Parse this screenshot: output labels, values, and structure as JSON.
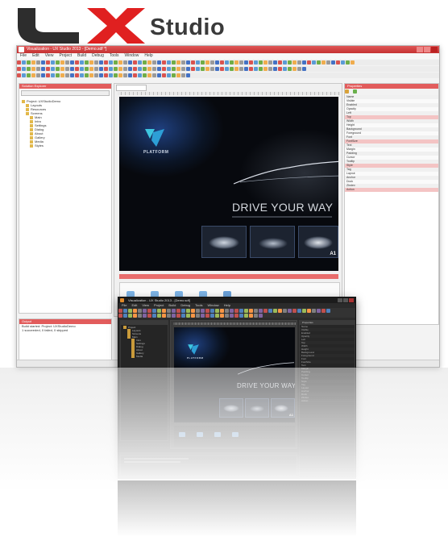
{
  "logo": {
    "brand_letters": "UX",
    "product": "Studio"
  },
  "light_window": {
    "title": "Visualization - UX Studio 2013 - [Demo.sdf *]",
    "menu": [
      "File",
      "Edit",
      "View",
      "Project",
      "Build",
      "Debug",
      "Tools",
      "Window",
      "Help"
    ],
    "left_panel_title": "Solution Explorer",
    "tree": [
      "Project: UXStudioDemo",
      "Layouts",
      "Resources",
      "Screens",
      "Main",
      "Intro",
      "Settings",
      "Dialog",
      "About",
      "Gallery",
      "Media",
      "Styles"
    ],
    "properties_title": "Properties",
    "properties": [
      "Name",
      "Visible",
      "Enabled",
      "Opacity",
      "Left",
      "Top",
      "Width",
      "Height",
      "Background",
      "Foreground",
      "Font",
      "FontSize",
      "Text",
      "Margin",
      "Padding",
      "Cursor",
      "Tooltip",
      "Style",
      "Tag",
      "Layout",
      "Anchor",
      "Dock",
      "ZIndex",
      "Action"
    ],
    "output_title": "Output",
    "output_lines": [
      "Build started: Project: UXStudioDemo",
      "1 succeeded, 0 failed, 0 skipped"
    ]
  },
  "dark_window": {
    "title": "Visualization - UX Studio 2013 - [Demo.sdf]",
    "menu": [
      "File",
      "Edit",
      "View",
      "Project",
      "Build",
      "Debug",
      "Tools",
      "Window",
      "Help"
    ],
    "tree": [
      "Project",
      "Layouts",
      "Screens",
      "Main",
      "Intro",
      "Settings",
      "Dialog",
      "About",
      "Gallery",
      "Media"
    ],
    "properties_title": "Properties"
  },
  "design": {
    "brand": "PLATFORM",
    "headline_light": "DRIVE YOUR WAY",
    "headline_dark": "DRIVE YOUR WAY",
    "thumb_label": "A1"
  },
  "colors": {
    "light_accent": "#d43a3a",
    "dark_bg": "#2b2b2b",
    "logo_red": "#e02020"
  }
}
